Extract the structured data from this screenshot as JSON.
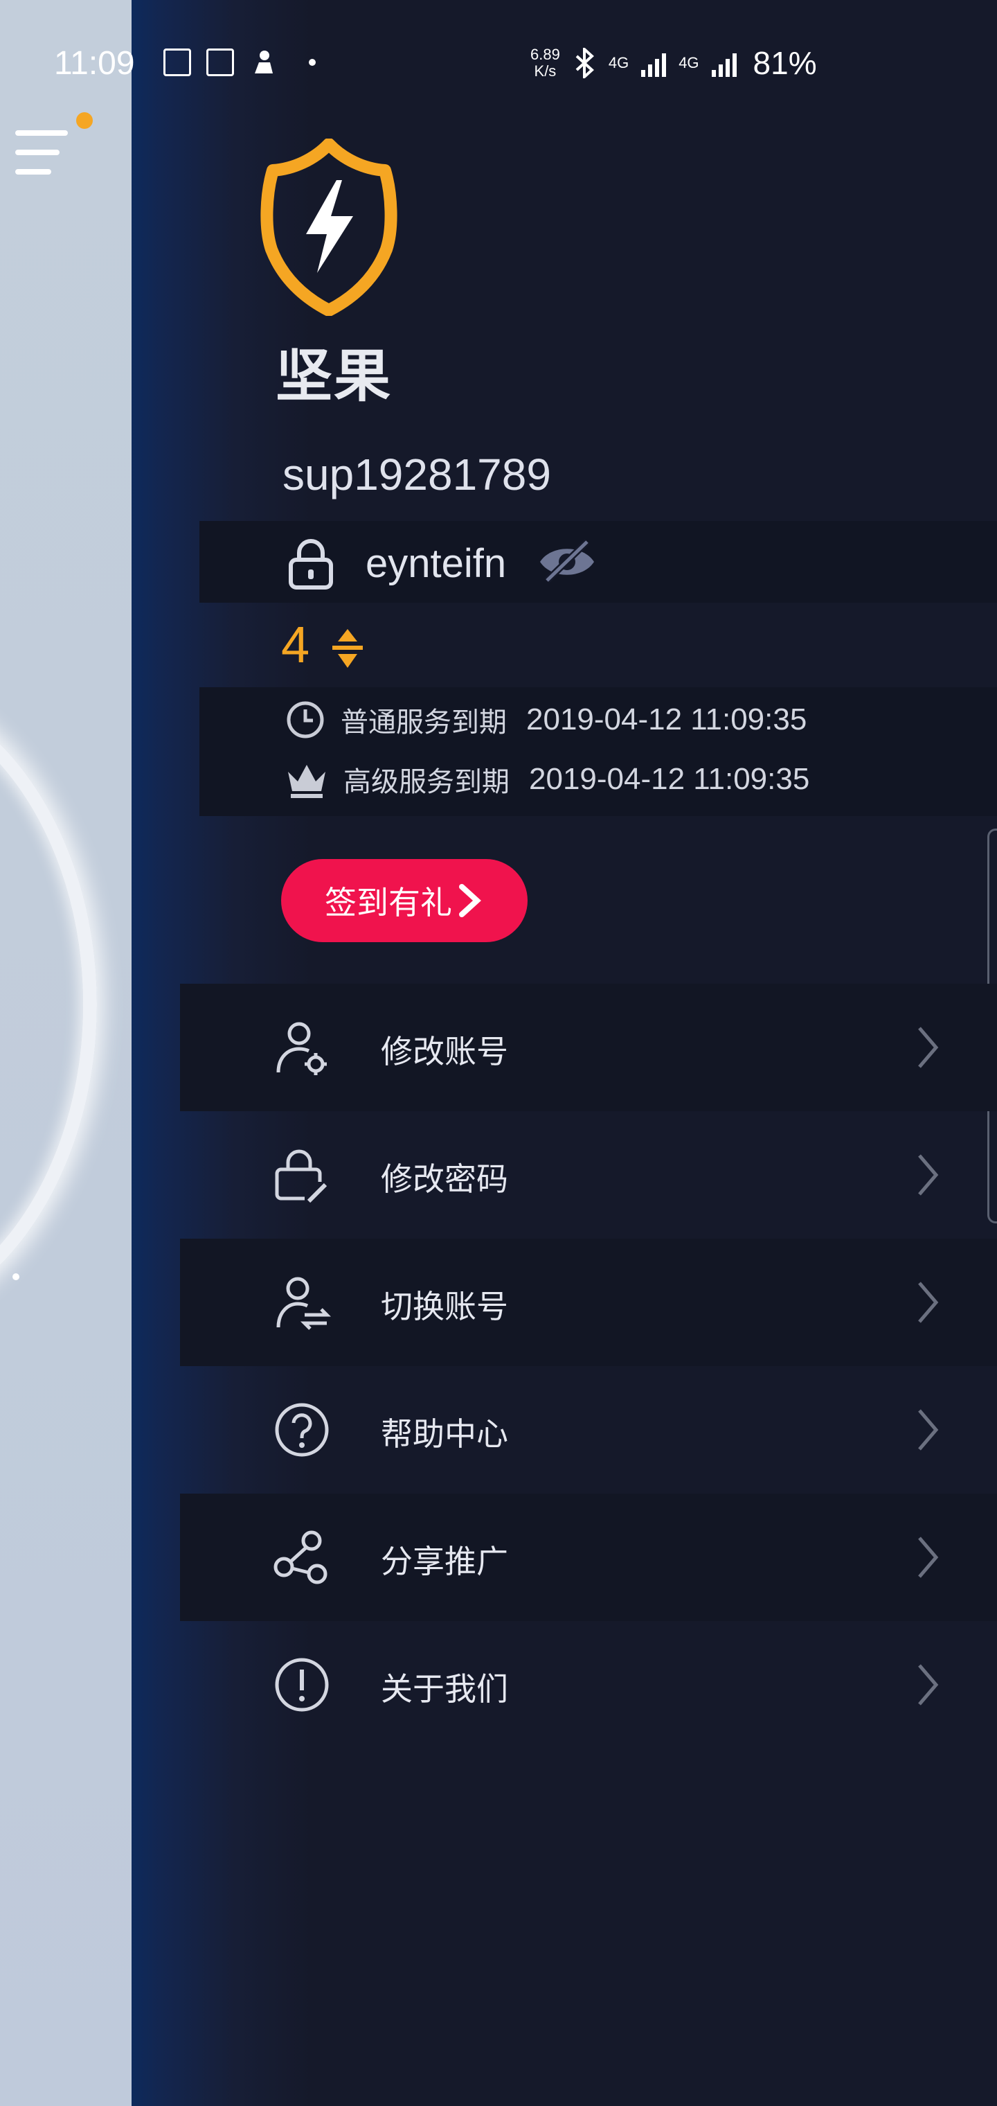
{
  "status_bar": {
    "time": "11:09",
    "net_speed_value": "6.89",
    "net_speed_unit": "K/s",
    "network_label_1": "4G",
    "network_label_2": "4G",
    "battery": "81%"
  },
  "drawer": {
    "app_name": "坚果",
    "username": "sup19281789",
    "password": "eynteifn",
    "coins": "4",
    "services": [
      {
        "label": "普通服务到期",
        "value": "2019-04-12 11:09:35",
        "icon": "clock-icon"
      },
      {
        "label": "高级服务到期",
        "value": "2019-04-12 11:09:35",
        "icon": "crown-icon"
      }
    ],
    "signin_label": "签到有礼",
    "menu": [
      {
        "label": "修改账号",
        "icon": "user-settings-icon"
      },
      {
        "label": "修改密码",
        "icon": "lock-edit-icon"
      },
      {
        "label": "切换账号",
        "icon": "user-switch-icon"
      },
      {
        "label": "帮助中心",
        "icon": "help-icon"
      },
      {
        "label": "分享推广",
        "icon": "share-icon"
      },
      {
        "label": "关于我们",
        "icon": "info-icon"
      }
    ]
  },
  "colors": {
    "drawer_bg": "#15192a",
    "accent_gold": "#f5a623",
    "signin_red": "#f0134d"
  }
}
